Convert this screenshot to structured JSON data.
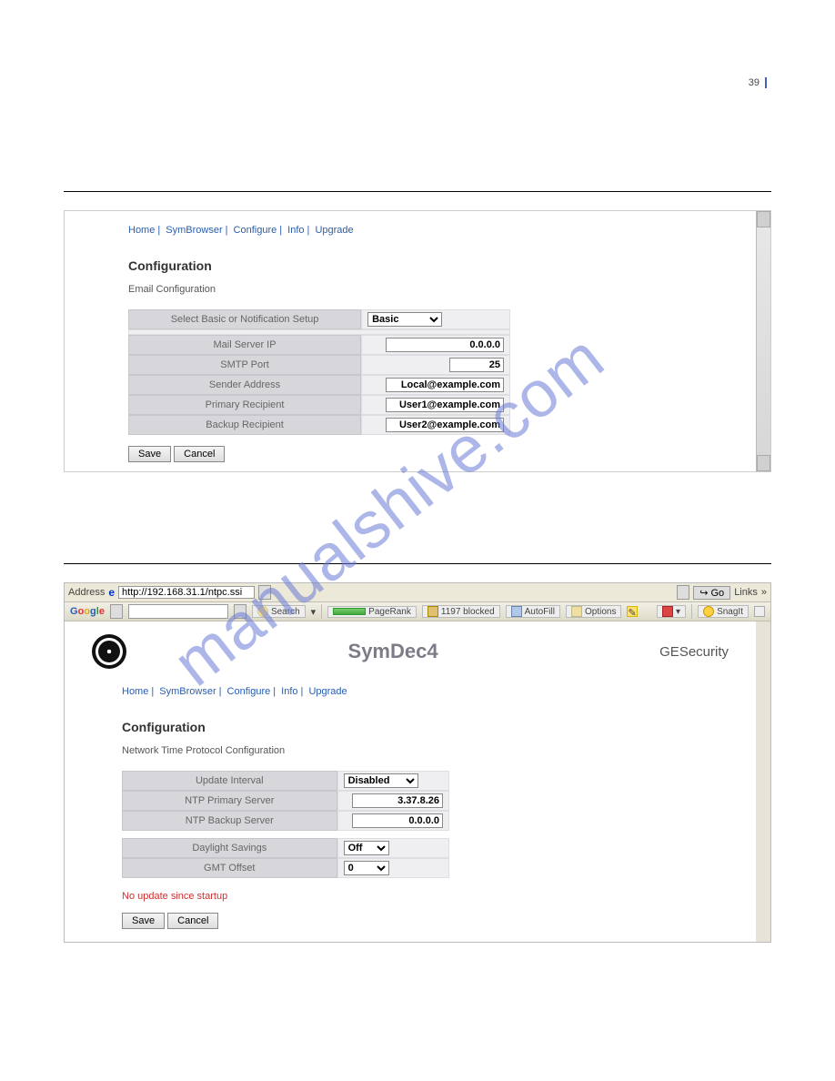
{
  "page_number": "39",
  "watermark": "manualshive.com",
  "nav": {
    "home": "Home",
    "symbrowser": "SymBrowser",
    "configure": "Configure",
    "info": "Info",
    "upgrade": "Upgrade"
  },
  "panel1": {
    "title": "Configuration",
    "subtitle": "Email Configuration",
    "setup_label": "Select Basic or Notification Setup",
    "setup_value": "Basic",
    "rows": [
      {
        "label": "Mail Server IP",
        "value": "0.0.0.0"
      },
      {
        "label": "SMTP Port",
        "value": "25"
      },
      {
        "label": "Sender Address",
        "value": "Local@example.com"
      },
      {
        "label": "Primary Recipient",
        "value": "User1@example.com"
      },
      {
        "label": "Backup Recipient",
        "value": "User2@example.com"
      }
    ],
    "save": "Save",
    "cancel": "Cancel"
  },
  "panel2": {
    "address_label": "Address",
    "url": "http://192.168.31.1/ntpc.ssi",
    "go": "Go",
    "links": "Links",
    "google": {
      "search_btn": "Search",
      "pagerank": "PageRank",
      "blocked": "1197 blocked",
      "autofill": "AutoFill",
      "options": "Options",
      "snagit": "SnagIt"
    },
    "brand_title": "SymDec4",
    "brand_right": {
      "ge": "GE",
      "sec": "Security"
    },
    "title": "Configuration",
    "subtitle": "Network Time Protocol Configuration",
    "rows1": [
      {
        "label": "Update Interval",
        "type": "select",
        "value": "Disabled"
      },
      {
        "label": "NTP Primary Server",
        "type": "text",
        "value": "3.37.8.26"
      },
      {
        "label": "NTP Backup Server",
        "type": "text",
        "value": "0.0.0.0"
      }
    ],
    "rows2": [
      {
        "label": "Daylight Savings",
        "type": "select",
        "value": "Off"
      },
      {
        "label": "GMT Offset",
        "type": "select",
        "value": "0"
      }
    ],
    "status": "No update since startup",
    "save": "Save",
    "cancel": "Cancel"
  }
}
